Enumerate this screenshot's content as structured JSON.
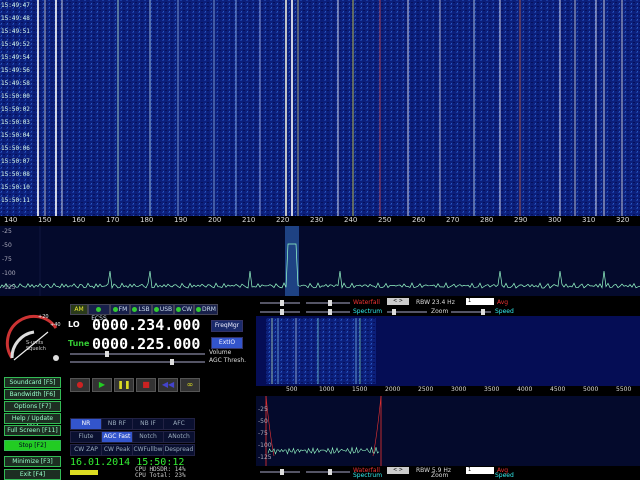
{
  "main_waterfall": {
    "time_labels": [
      "15:49:47",
      "15:49:48",
      "15:49:51",
      "15:49:52",
      "15:49:54",
      "15:49:56",
      "15:49:58",
      "15:50:00",
      "15:50:02",
      "15:50:03",
      "15:50:04",
      "15:50:06",
      "15:50:07",
      "15:50:08",
      "15:50:10",
      "15:50:11"
    ]
  },
  "main_freq_scale": {
    "labels": [
      "140",
      "150",
      "160",
      "170",
      "180",
      "190",
      "200",
      "210",
      "220",
      "230",
      "240",
      "250",
      "260",
      "270",
      "280",
      "290",
      "300",
      "310",
      "320"
    ]
  },
  "main_spectrum": {
    "db_labels": [
      "-25",
      "-50",
      "-75",
      "-100",
      "-125"
    ]
  },
  "sidebar": {
    "buttons": [
      "Soundcard [F5]",
      "Bandwidth [F6]",
      "Options [F7]",
      "Help / Update [F1]",
      "Full Screen [F11]",
      "Stop [F2]",
      "Minimize [F3]",
      "Exit [F4]"
    ]
  },
  "smeter": {
    "label": "S-units Squelch",
    "scale": [
      "+20",
      "+40"
    ]
  },
  "modes": [
    "AM",
    "ECSS",
    "FM",
    "LSB",
    "USB",
    "CW",
    "DRM"
  ],
  "lo": {
    "label": "LO",
    "value": "0000.234.000"
  },
  "tune": {
    "label": "Tune",
    "value": "0000.225.000"
  },
  "buttons": {
    "freqmgr": "FreqMgr",
    "extio": "ExtIO"
  },
  "labels": {
    "volume": "Volume",
    "agc": "AGC Thresh."
  },
  "dsp_row1": [
    "NR",
    "NB RF",
    "NB IF",
    "AFC"
  ],
  "dsp_row2": [
    "Flute",
    "AGC Fast",
    "Notch",
    "ANotch"
  ],
  "dsp_row3": [
    "CW ZAP",
    "CW Peak",
    "CWFullbw",
    "Despread"
  ],
  "datetime": "16.01.2014 15:50:12",
  "cpu": {
    "line1": "CPU HDSDR: 14%",
    "line2": "CPU Total: 23%"
  },
  "upper_controls": {
    "waterfall": "Waterfall",
    "spectrum": "Spectrum",
    "rbw": "RBW 23.4 Hz",
    "rbw_sel": "1",
    "avg": "Avg",
    "zoom": "Zoom",
    "speed": "Speed"
  },
  "upper_scale": [
    "500",
    "1000",
    "1500",
    "2000",
    "2500",
    "3000",
    "3500",
    "4000",
    "4500",
    "5000",
    "5500"
  ],
  "lower_db": [
    "-25",
    "-50",
    "-75",
    "-100",
    "-125"
  ],
  "lower_controls": {
    "waterfall": "Waterfall",
    "spectrum": "Spectrum",
    "rbw": "RBW 5.9 Hz",
    "rbw_sel": "1",
    "avg": "Avg",
    "zoom": "Zoom",
    "speed": "Speed"
  },
  "colors": {
    "waterfall_bg": "#0a1a6e",
    "spectrum_bg": "#040a2c",
    "accent": "#3355cc",
    "green": "#22cc22"
  }
}
